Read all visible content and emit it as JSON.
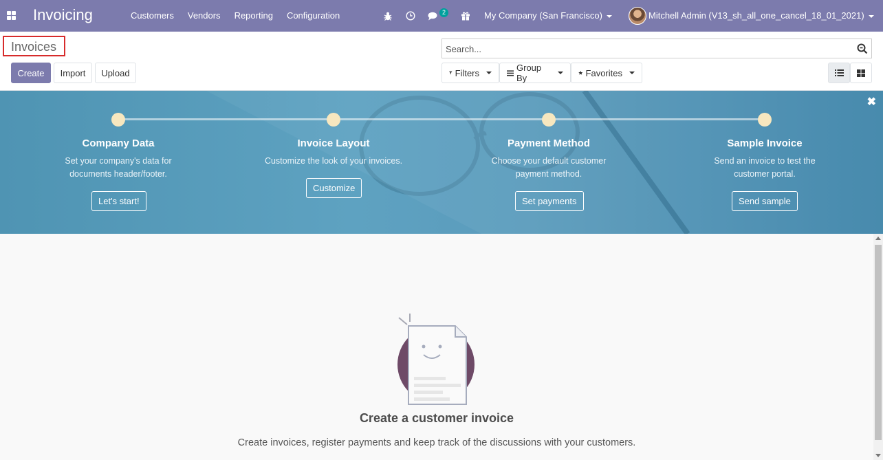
{
  "navbar": {
    "app_title": "Invoicing",
    "menu": [
      "Customers",
      "Vendors",
      "Reporting",
      "Configuration"
    ],
    "chat_badge": "2",
    "company": "My Company (San Francisco)",
    "user": "Mitchell Admin (V13_sh_all_one_cancel_18_01_2021)"
  },
  "control": {
    "breadcrumb": "Invoices",
    "buttons": {
      "create": "Create",
      "import": "Import",
      "upload": "Upload"
    },
    "search_placeholder": "Search...",
    "filters": "Filters",
    "group_by": "Group By",
    "favorites": "Favorites"
  },
  "onboarding": {
    "steps": [
      {
        "title": "Company Data",
        "desc": "Set your company's data for documents header/footer.",
        "button": "Let's start!"
      },
      {
        "title": "Invoice Layout",
        "desc": "Customize the look of your invoices.",
        "button": "Customize"
      },
      {
        "title": "Payment Method",
        "desc": "Choose your default customer payment method.",
        "button": "Set payments"
      },
      {
        "title": "Sample Invoice",
        "desc": "Send an invoice to test the customer portal.",
        "button": "Send sample"
      }
    ]
  },
  "empty": {
    "title": "Create a customer invoice",
    "desc": "Create invoices, register payments and keep track of the discussions with your customers."
  },
  "colors": {
    "navbar": "#7c7bad",
    "banner": "#5ea2c1",
    "step_dot": "#f7e7bf",
    "badge": "#00a09d"
  },
  "icons": [
    "apps-icon",
    "bug-icon",
    "clock-icon",
    "chat-icon",
    "gift-icon",
    "search-icon",
    "filter-icon",
    "group-by-icon",
    "star-icon",
    "list-view-icon",
    "kanban-view-icon",
    "close-icon"
  ]
}
